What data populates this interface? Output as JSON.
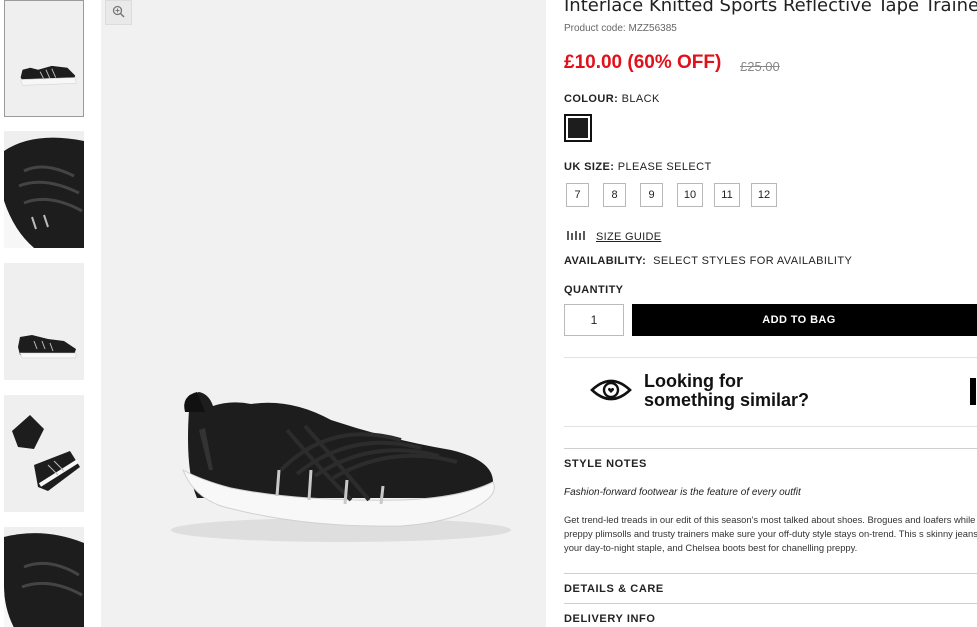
{
  "product": {
    "title": "Interlace Knitted Sports Reflective Tape Trainer",
    "code": "Product code: MZZ56385",
    "price": "£10.00 (60% OFF)",
    "was_price": "£25.00",
    "colour_label": "COLOUR:",
    "colour_value": "BLACK",
    "size_label": "UK SIZE:",
    "size_value": "PLEASE SELECT",
    "sizes": [
      "7",
      "8",
      "9",
      "10",
      "11",
      "12"
    ],
    "size_guide": "SIZE GUIDE",
    "availability_label": "AVAILABILITY:",
    "availability_value": "SELECT STYLES FOR AVAILABILITY",
    "quantity_label": "QUANTITY",
    "quantity_value": "1",
    "add_to_bag": "ADD TO BAG"
  },
  "similar": {
    "line1": "Looking for",
    "line2": "something similar?"
  },
  "style_notes": {
    "heading": "STYLE NOTES",
    "tagline": "Fashion-forward footwear is the feature of every outfit",
    "body": "Get trend-led treads in our edit of this season's most talked about shoes. Brogues and loafers while preppy plimsolls and trusty trainers make sure your off-duty style stays on-trend. This s skinny jeans are your day-to-night staple, and Chelsea boots best for chanelling preppy."
  },
  "details_heading": "DETAILS & CARE",
  "delivery_heading": "DELIVERY INFO",
  "colors": {
    "sale_red": "#e0111b",
    "shoe": "#1d1d1d",
    "sole": "#f4f4f4",
    "background": "#f1f1f1"
  },
  "icons": [
    "zoom-icon",
    "size-guide-icon",
    "eye-icon"
  ]
}
